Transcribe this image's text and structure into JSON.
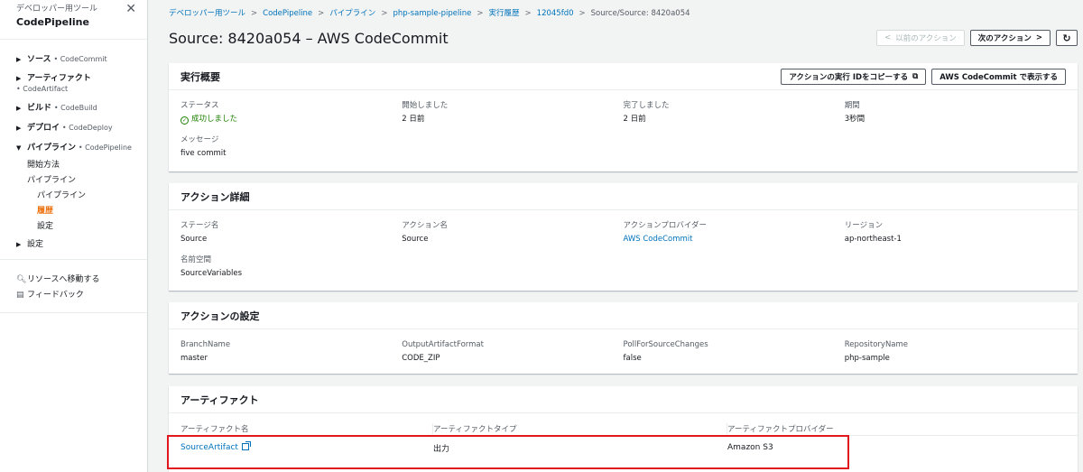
{
  "sidebar": {
    "subtitle": "デベロッパー用ツール",
    "title": "CodePipeline",
    "groups": [
      {
        "name": "ソース",
        "service": "• CodeCommit"
      },
      {
        "name": "アーティファクト",
        "service": "• CodeArtifact"
      },
      {
        "name": "ビルド",
        "service": "• CodeBuild"
      },
      {
        "name": "デプロイ",
        "service": "• CodeDeploy"
      },
      {
        "name": "パイプライン",
        "service": "• CodePipeline"
      }
    ],
    "pipeline_children": {
      "getting_started": "開始方法",
      "pipelines": "パイプライン",
      "pipeline": "パイプライン",
      "history": "履歴",
      "settings": "設定"
    },
    "settings_group": "設定",
    "go_to_resource": "リソースへ移動する",
    "feedback": "フィードバック"
  },
  "breadcrumbs": {
    "items": [
      "デベロッパー用ツール",
      "CodePipeline",
      "パイプライン",
      "php-sample-pipeline",
      "実行履歴",
      "12045fd0"
    ],
    "current": "Source/Source: 8420a054"
  },
  "page": {
    "title": "Source: 8420a054 – AWS CodeCommit",
    "prev_action": "以前のアクション",
    "next_action": "次のアクション",
    "refresh_icon": "refresh-icon"
  },
  "summary": {
    "heading": "実行概要",
    "copy_id_btn": "アクションの実行 IDをコピーする",
    "view_in_btn": "AWS CodeCommit で表示する",
    "status_label": "ステータス",
    "status_value": "成功しました",
    "started_label": "開始しました",
    "started_value": "2 日前",
    "completed_label": "完了しました",
    "completed_value": "2 日前",
    "duration_label": "期間",
    "duration_value": "3秒間",
    "message_label": "メッセージ",
    "message_value": "five commit"
  },
  "details": {
    "heading": "アクション詳細",
    "stage_label": "ステージ名",
    "stage_value": "Source",
    "action_label": "アクション名",
    "action_value": "Source",
    "provider_label": "アクションプロバイダー",
    "provider_value": "AWS CodeCommit",
    "region_label": "リージョン",
    "region_value": "ap-northeast-1",
    "namespace_label": "名前空間",
    "namespace_value": "SourceVariables"
  },
  "config": {
    "heading": "アクションの設定",
    "items": [
      {
        "label": "BranchName",
        "value": "master"
      },
      {
        "label": "OutputArtifactFormat",
        "value": "CODE_ZIP"
      },
      {
        "label": "PollForSourceChanges",
        "value": "false"
      },
      {
        "label": "RepositoryName",
        "value": "php-sample"
      }
    ]
  },
  "artifacts": {
    "heading": "アーティファクト",
    "columns": [
      "アーティファクト名",
      "アーティファクトタイプ",
      "アーティファクトプロバイダー"
    ],
    "rows": [
      {
        "name": "SourceArtifact",
        "type": "出力",
        "provider": "Amazon S3"
      }
    ]
  },
  "colors": {
    "link": "#0073bb",
    "active": "#ec7211",
    "success": "#1d8102",
    "highlight": "#e0181e"
  }
}
